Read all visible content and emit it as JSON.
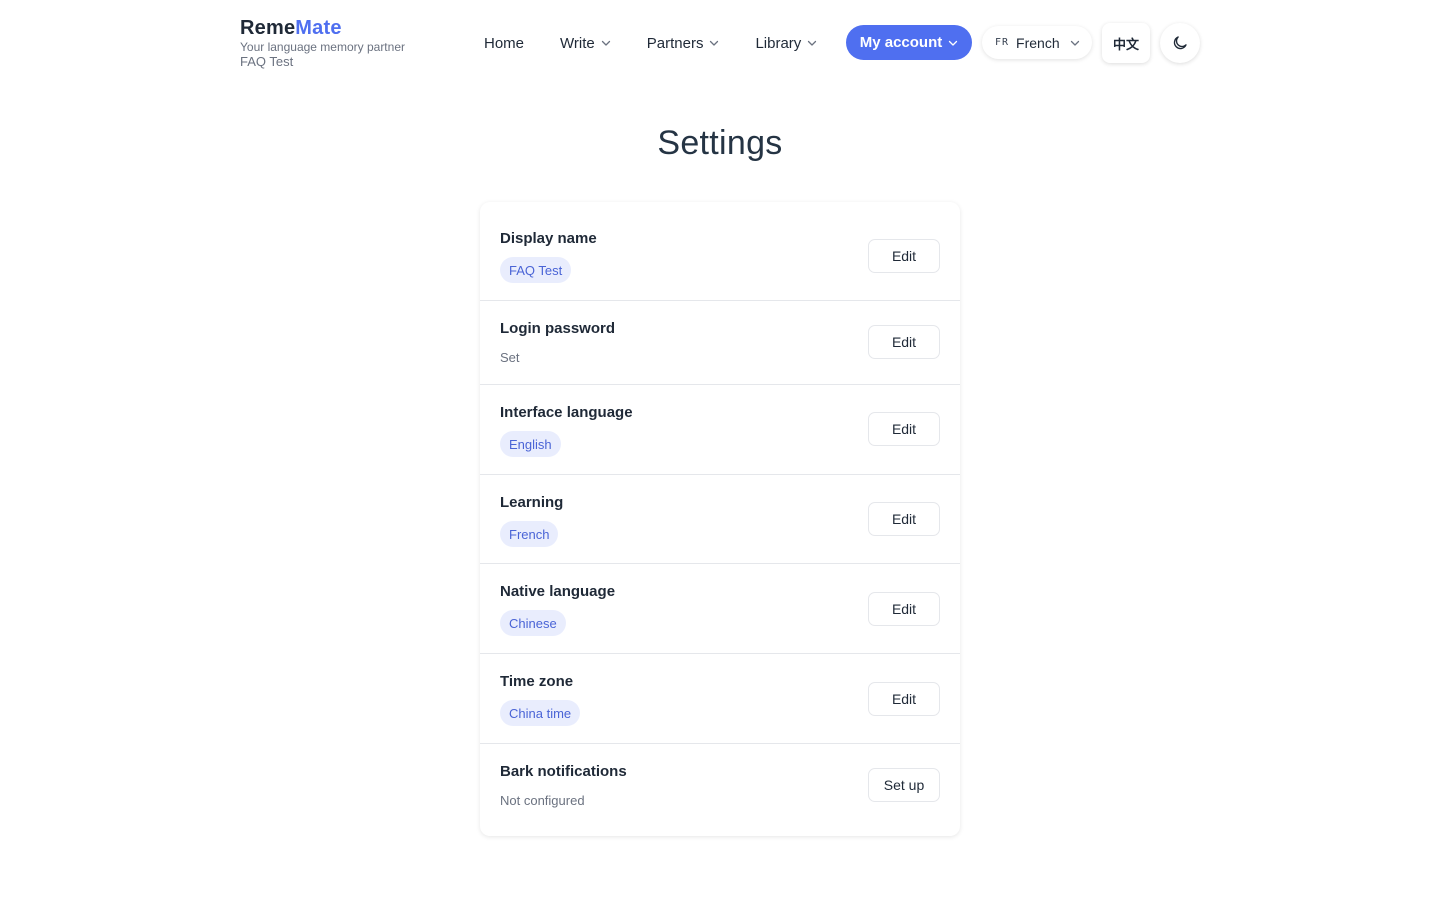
{
  "brand": {
    "name_part1": "Reme",
    "name_part2": "Mate",
    "tagline": "Your language memory partner",
    "user": "FAQ Test",
    "accent_color": "#4f6ff0"
  },
  "nav": {
    "items": [
      {
        "label": "Home",
        "has_dropdown": false
      },
      {
        "label": "Write",
        "has_dropdown": true
      },
      {
        "label": "Partners",
        "has_dropdown": true
      },
      {
        "label": "Library",
        "has_dropdown": true
      }
    ],
    "account_label": "My account",
    "language": {
      "code": "FR",
      "name": "French"
    },
    "locale_toggle": "中文",
    "theme_icon": "moon-icon"
  },
  "page": {
    "title": "Settings"
  },
  "settings": [
    {
      "label": "Display name",
      "value": "FAQ Test",
      "value_style": "chip",
      "action": "Edit"
    },
    {
      "label": "Login password",
      "value": "Set",
      "value_style": "text",
      "action": "Edit"
    },
    {
      "label": "Interface language",
      "value": "English",
      "value_style": "chip",
      "action": "Edit"
    },
    {
      "label": "Learning",
      "value": "French",
      "value_style": "chip",
      "action": "Edit"
    },
    {
      "label": "Native language",
      "value": "Chinese",
      "value_style": "chip",
      "action": "Edit"
    },
    {
      "label": "Time zone",
      "value": "China time",
      "value_style": "chip",
      "action": "Edit"
    },
    {
      "label": "Bark notifications",
      "value": "Not configured",
      "value_style": "text",
      "action": "Set up"
    }
  ]
}
